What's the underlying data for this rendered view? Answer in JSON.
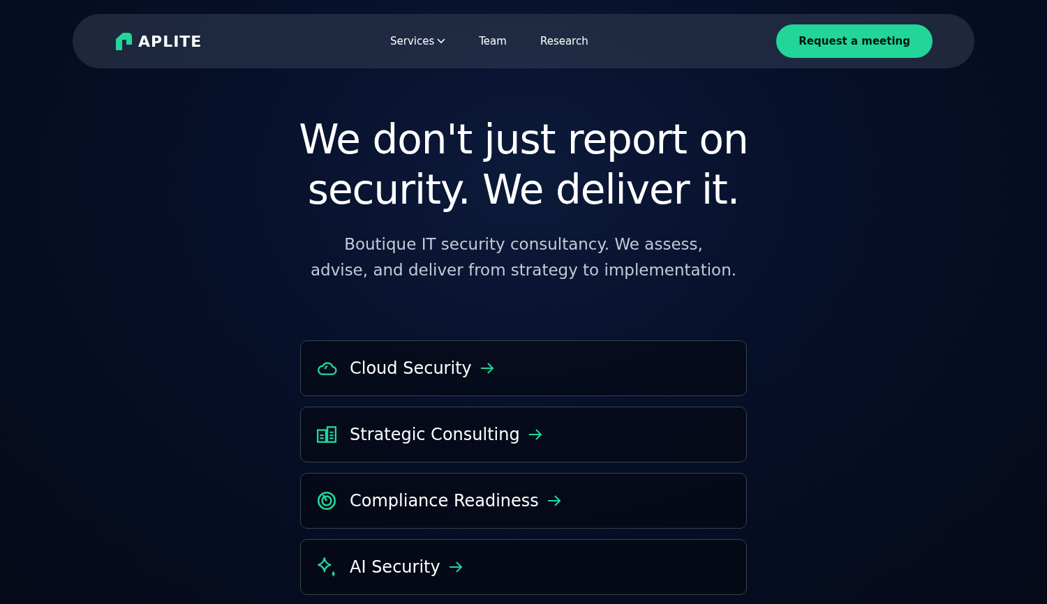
{
  "navbar": {
    "logo": "APLITE",
    "links": [
      {
        "label": "Services",
        "dropdown": true
      },
      {
        "label": "Team",
        "dropdown": false
      },
      {
        "label": "Research",
        "dropdown": false
      }
    ],
    "cta": "Request a meeting"
  },
  "hero": {
    "title_lines": [
      "We don't just report on",
      "security. We deliver it."
    ],
    "subtitle_lines": [
      "Boutique IT security consultancy. We assess,",
      "advise, and deliver from strategy to implementation."
    ]
  },
  "services": [
    {
      "label": "Cloud Security",
      "kind": "cloud"
    },
    {
      "label": "Strategic Consulting",
      "kind": "chart"
    },
    {
      "label": "Compliance Readiness",
      "kind": "target"
    },
    {
      "label": "AI Security",
      "kind": "sparkle"
    }
  ]
}
